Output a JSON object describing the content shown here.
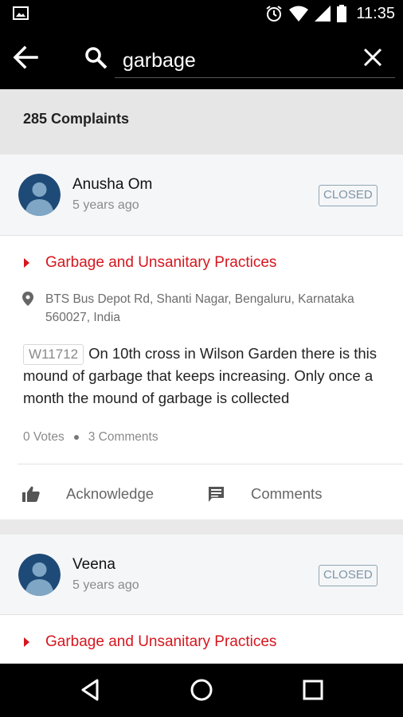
{
  "status_bar": {
    "time": "11:35"
  },
  "search": {
    "query": "garbage"
  },
  "results": {
    "count_label": "285 Complaints"
  },
  "complaints": [
    {
      "author": "Anusha Om",
      "time_ago": "5 years ago",
      "status": "CLOSED",
      "category": "Garbage and Unsanitary Practices",
      "address": "BTS Bus Depot Rd, Shanti Nagar, Bengaluru, Karnataka 560027, India",
      "id": "W11712",
      "description": "On 10th cross in Wilson Garden there is this mound of garbage that keeps increasing. Only once a month the mound of garbage is collected",
      "votes": "0 Votes",
      "comments": "3 Comments"
    },
    {
      "author": "Veena",
      "time_ago": "5 years ago",
      "status": "CLOSED",
      "category": "Garbage and Unsanitary Practices"
    }
  ],
  "actions": {
    "acknowledge": "Acknowledge",
    "comments": "Comments"
  },
  "colors": {
    "accent_red": "#d6161e",
    "badge": "#8ea6b6",
    "app_bar": "#000000"
  },
  "icons": [
    "image-icon",
    "alarm-icon",
    "wifi-icon",
    "signal-icon",
    "battery-icon",
    "back-arrow-icon",
    "search-icon",
    "close-icon",
    "location-pin-icon",
    "thumbs-up-icon",
    "comment-icon",
    "nav-back-icon",
    "nav-home-icon",
    "nav-recents-icon"
  ]
}
